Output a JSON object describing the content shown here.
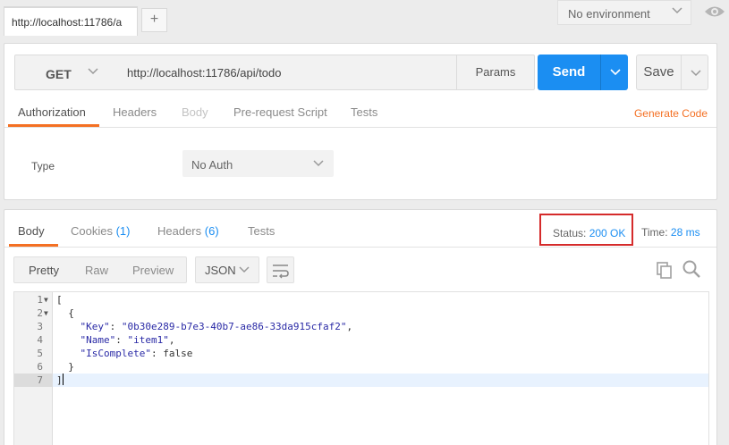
{
  "top": {
    "tab_label": "http://localhost:11786/a",
    "add_tab": "+",
    "environment": "No environment"
  },
  "request": {
    "method": "GET",
    "url": "http://localhost:11786/api/todo",
    "params_label": "Params",
    "send_label": "Send",
    "save_label": "Save",
    "tabs": [
      {
        "label": "Authorization",
        "state": "active"
      },
      {
        "label": "Headers",
        "state": "normal"
      },
      {
        "label": "Body",
        "state": "disabled"
      },
      {
        "label": "Pre-request Script",
        "state": "normal"
      },
      {
        "label": "Tests",
        "state": "normal"
      }
    ],
    "generate_code": "Generate Code",
    "auth": {
      "type_label": "Type",
      "type_value": "No Auth"
    }
  },
  "response": {
    "tabs": {
      "body": "Body",
      "cookies": "Cookies",
      "cookies_count": "(1)",
      "headers": "Headers",
      "headers_count": "(6)",
      "tests": "Tests"
    },
    "status_label": "Status:",
    "status_value": "200 OK",
    "time_label": "Time:",
    "time_value": "28 ms",
    "view": {
      "pretty": "Pretty",
      "raw": "Raw",
      "preview": "Preview",
      "format": "JSON"
    },
    "code": {
      "line_numbers": [
        "1",
        "2",
        "3",
        "4",
        "5",
        "6",
        "7"
      ],
      "open_bracket": "[",
      "open_brace": "{",
      "key1": "\"Key\"",
      "val1": "\"0b30e289-b7e3-40b7-ae86-33da915cfaf2\"",
      "key2": "\"Name\"",
      "val2": "\"item1\"",
      "key3": "\"IsComplete\"",
      "val3": "false",
      "close_brace": "}",
      "close_bracket": "]"
    }
  },
  "colors": {
    "accent": "#f47023",
    "primary": "#1b8ef2",
    "status_highlight": "#d52b2b"
  }
}
